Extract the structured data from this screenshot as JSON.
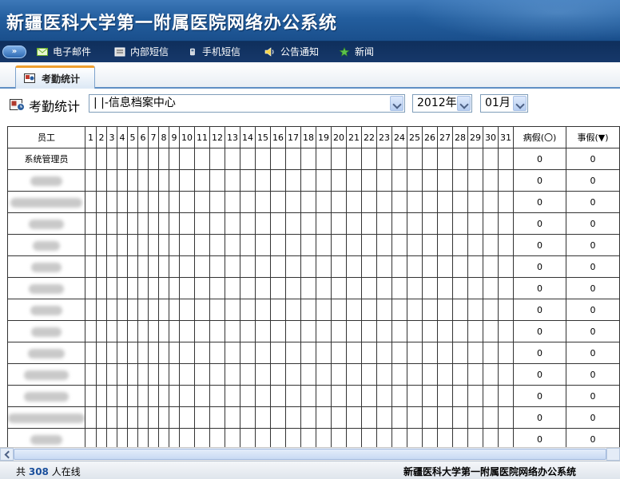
{
  "app": {
    "title": "新疆医科大学第一附属医院网络办公系统"
  },
  "menu": {
    "toggle_label": "»",
    "items": [
      {
        "label": "电子邮件",
        "icon": "envelope-icon"
      },
      {
        "label": "内部短信",
        "icon": "message-icon"
      },
      {
        "label": "手机短信",
        "icon": "phone-icon"
      },
      {
        "label": "公告通知",
        "icon": "speaker-icon"
      },
      {
        "label": "新闻",
        "icon": "star-icon"
      }
    ]
  },
  "tabs": [
    {
      "label": "考勤统计",
      "icon": "attendance-icon",
      "active": true
    }
  ],
  "toolbar": {
    "page_title": "考勤统计",
    "department_select": "| |-信息档案中心",
    "year_select": "2012年",
    "month_select": "01月"
  },
  "table": {
    "employee_header": "员工",
    "day_headers": [
      "1",
      "2",
      "3",
      "4",
      "5",
      "6",
      "7",
      "8",
      "9",
      "10",
      "11",
      "12",
      "13",
      "14",
      "15",
      "16",
      "17",
      "18",
      "19",
      "20",
      "21",
      "22",
      "23",
      "24",
      "25",
      "26",
      "27",
      "28",
      "29",
      "30",
      "31"
    ],
    "sick_leave_header": "病假(〇)",
    "personal_leave_header": "事假(▼)",
    "rows": [
      {
        "employee": "系统管理员",
        "sick": "0",
        "personal": "0"
      },
      {
        "employee": "",
        "sick": "0",
        "personal": "0"
      },
      {
        "employee": "",
        "sick": "0",
        "personal": "0"
      },
      {
        "employee": "",
        "sick": "0",
        "personal": "0"
      },
      {
        "employee": "",
        "sick": "0",
        "personal": "0"
      },
      {
        "employee": "",
        "sick": "0",
        "personal": "0"
      },
      {
        "employee": "",
        "sick": "0",
        "personal": "0"
      },
      {
        "employee": "",
        "sick": "0",
        "personal": "0"
      },
      {
        "employee": "",
        "sick": "0",
        "personal": "0"
      },
      {
        "employee": "",
        "sick": "0",
        "personal": "0"
      },
      {
        "employee": "",
        "sick": "0",
        "personal": "0"
      },
      {
        "employee": "",
        "sick": "0",
        "personal": "0"
      },
      {
        "employee": "",
        "sick": "0",
        "personal": "0"
      },
      {
        "employee": "",
        "sick": "0",
        "personal": "0"
      }
    ]
  },
  "status": {
    "online_prefix": "共",
    "online_count": "308",
    "online_suffix": "人在线",
    "footer_title": "新疆医科大学第一附属医院网络办公系统"
  }
}
